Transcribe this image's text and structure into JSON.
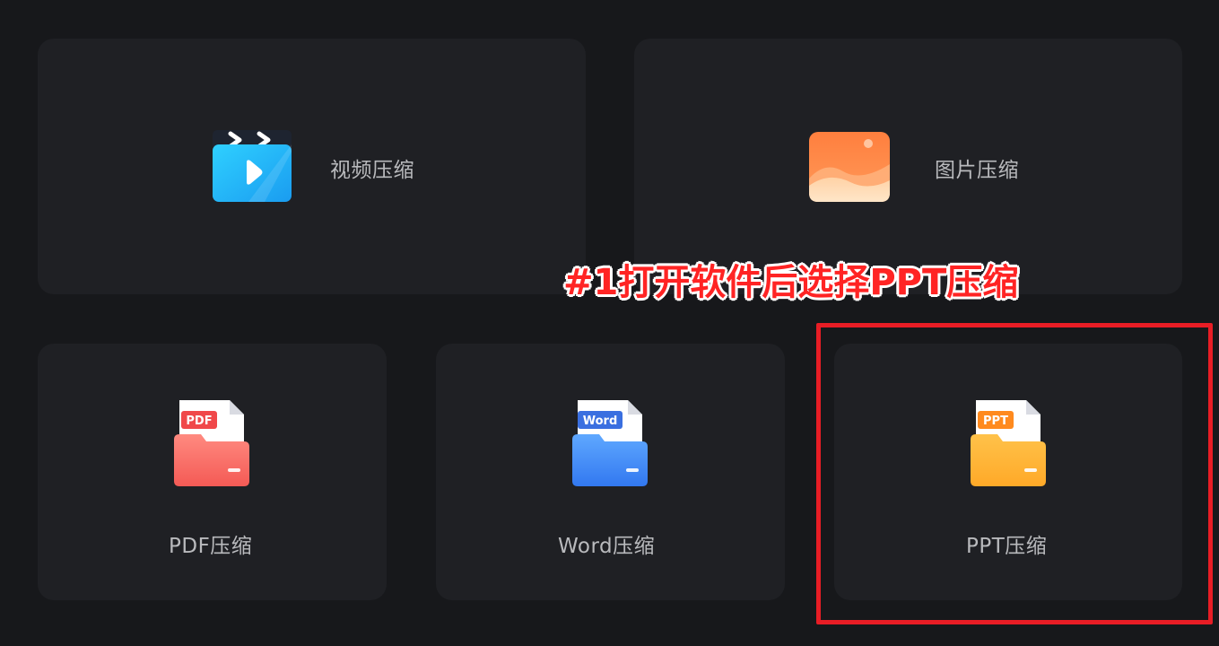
{
  "tools": {
    "video": {
      "label": "视频压缩",
      "icon": "video-clapper-icon"
    },
    "image": {
      "label": "图片压缩",
      "icon": "image-landscape-icon"
    },
    "pdf": {
      "label": "PDF压缩",
      "icon": "pdf-folder-icon",
      "badge": "PDF"
    },
    "word": {
      "label": "Word压缩",
      "icon": "word-folder-icon",
      "badge": "Word"
    },
    "ppt": {
      "label": "PPT压缩",
      "icon": "ppt-folder-icon",
      "badge": "PPT"
    }
  },
  "annotation": {
    "text": "#1打开软件后选择PPT压缩",
    "color": "#ff2424"
  },
  "colors": {
    "background": "#17181b",
    "card": "#1f2024",
    "label": "#b9babd",
    "highlight_box": "#e81d25"
  }
}
